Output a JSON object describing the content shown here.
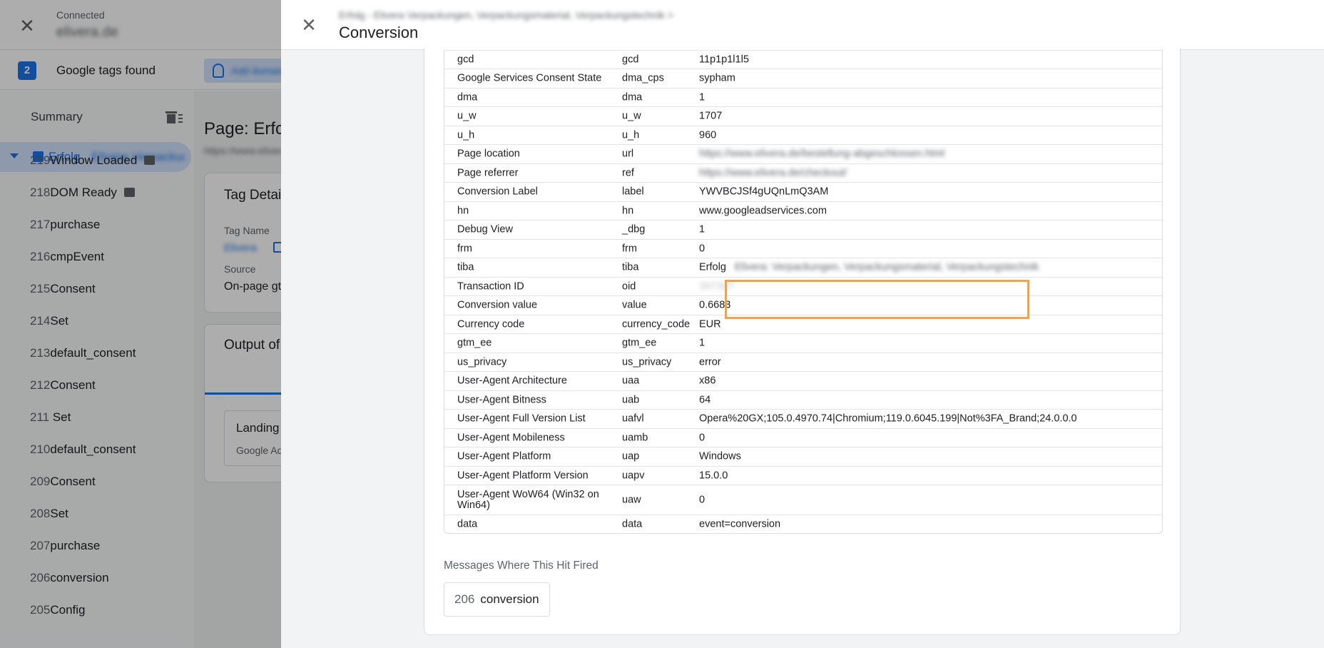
{
  "background": {
    "connection_status": "Connected",
    "connected_site": "elivera.de",
    "tags_count": "2",
    "tags_found_label": "Google tags found",
    "add_domain_label": "Add domain",
    "summary_label": "Summary",
    "active_page": {
      "label": "Erfolg",
      "sublabel": "Elivera Verpackungen"
    },
    "events": [
      {
        "num": "219",
        "name": "Window Loaded",
        "badge": true
      },
      {
        "num": "218",
        "name": "DOM Ready",
        "badge": true
      },
      {
        "num": "217",
        "name": "purchase",
        "badge": false
      },
      {
        "num": "216",
        "name": "cmpEvent",
        "badge": false
      },
      {
        "num": "215",
        "name": "Consent",
        "badge": false
      },
      {
        "num": "214",
        "name": "Set",
        "badge": false
      },
      {
        "num": "213",
        "name": "default_consent",
        "badge": false
      },
      {
        "num": "212",
        "name": "Consent",
        "badge": false
      },
      {
        "num": "211",
        "name": " Set",
        "badge": false
      },
      {
        "num": "210",
        "name": "default_consent",
        "badge": false
      },
      {
        "num": "209",
        "name": "Consent",
        "badge": false
      },
      {
        "num": "208",
        "name": "Set",
        "badge": false
      },
      {
        "num": "207",
        "name": "purchase",
        "badge": false
      },
      {
        "num": "206",
        "name": "conversion",
        "badge": false
      },
      {
        "num": "205",
        "name": "Config",
        "badge": false
      }
    ],
    "page_title": "Page: Erfolg",
    "page_url": "https://www.elivera.de",
    "tag_details": {
      "title": "Tag Details",
      "tag_name_label": "Tag Name",
      "tag_name_value": "Elivera",
      "source_label": "Source",
      "source_value": "On-page gtag"
    },
    "output": {
      "title": "Output of",
      "inner_title": "Landing",
      "inner_sub": "Google Ads"
    }
  },
  "panel": {
    "breadcrumb": "Erfolg - Elivera Verpackungen, Verpackungsmaterial, Verpackungstechnik >",
    "title": "Conversion",
    "rows": [
      {
        "name": "gcd",
        "key": "gcd",
        "value": "11p1p1l1l5",
        "blur": false,
        "h": 26
      },
      {
        "name": "Google Services Consent State",
        "key": "dma_cps",
        "value": "sypham",
        "blur": false,
        "h": 27
      },
      {
        "name": "dma",
        "key": "dma",
        "value": "1",
        "blur": false,
        "h": 26
      },
      {
        "name": "u_w",
        "key": "u_w",
        "value": "1707",
        "blur": false,
        "h": 27
      },
      {
        "name": "u_h",
        "key": "u_h",
        "value": "960",
        "blur": false,
        "h": 26
      },
      {
        "name": "Page location",
        "key": "url",
        "value": "https://www.elivera.de/bestellung-abgeschlossen.html",
        "blur": true,
        "h": 27
      },
      {
        "name": "Page referrer",
        "key": "ref",
        "value": "https://www.elivera.de/checkout/",
        "blur": true,
        "h": 26
      },
      {
        "name": "Conversion Label",
        "key": "label",
        "value": "YWVBCJSf4gUQnLmQ3AM",
        "blur": false,
        "h": 27
      },
      {
        "name": "hn",
        "key": "hn",
        "value": "www.googleadservices.com",
        "blur": false,
        "h": 26
      },
      {
        "name": "Debug View",
        "key": "_dbg",
        "value": "1",
        "blur": false,
        "h": 27
      },
      {
        "name": "frm",
        "key": "frm",
        "value": "0",
        "blur": false,
        "h": 26
      },
      {
        "name": "tiba",
        "key": "tiba",
        "value": "Erfolg",
        "suffix": "Elivera: Verpackungen, Verpackungsmaterial, Verpackungstechnik",
        "blur": false,
        "h": 27
      },
      {
        "name": "Transaction ID",
        "key": "oid",
        "value": "397327",
        "blur": true,
        "faint": true,
        "h": 26
      },
      {
        "name": "Conversion value",
        "key": "value",
        "value": "0.6683",
        "blur": false,
        "h": 27
      },
      {
        "name": "Currency code",
        "key": "currency_code",
        "value": "EUR",
        "blur": false,
        "h": 26
      },
      {
        "name": "gtm_ee",
        "key": "gtm_ee",
        "value": "1",
        "blur": false,
        "h": 27
      },
      {
        "name": "us_privacy",
        "key": "us_privacy",
        "value": "error",
        "blur": false,
        "h": 26
      },
      {
        "name": "User-Agent Architecture",
        "key": "uaa",
        "value": "x86",
        "blur": false,
        "h": 27
      },
      {
        "name": "User-Agent Bitness",
        "key": "uab",
        "value": "64",
        "blur": false,
        "h": 26
      },
      {
        "name": "User-Agent Full Version List",
        "key": "uafvl",
        "value": "Opera%20GX;105.0.4970.74|Chromium;119.0.6045.199|Not%3FA_Brand;24.0.0.0",
        "blur": false,
        "h": 27
      },
      {
        "name": "User-Agent Mobileness",
        "key": "uamb",
        "value": "0",
        "blur": false,
        "h": 26
      },
      {
        "name": "User-Agent Platform",
        "key": "uap",
        "value": "Windows",
        "blur": false,
        "h": 27
      },
      {
        "name": "User-Agent Platform Version",
        "key": "uapv",
        "value": "15.0.0",
        "blur": false,
        "h": 26
      },
      {
        "name": "User-Agent WoW64 (Win32 on Win64)",
        "key": "uaw",
        "value": "0",
        "blur": false,
        "h": 42
      },
      {
        "name": "data",
        "key": "data",
        "value": "event=conversion",
        "blur": false,
        "h": 26
      }
    ],
    "messages_label": "Messages Where This Hit Fired",
    "message_chip": {
      "num": "206",
      "label": "conversion"
    }
  }
}
